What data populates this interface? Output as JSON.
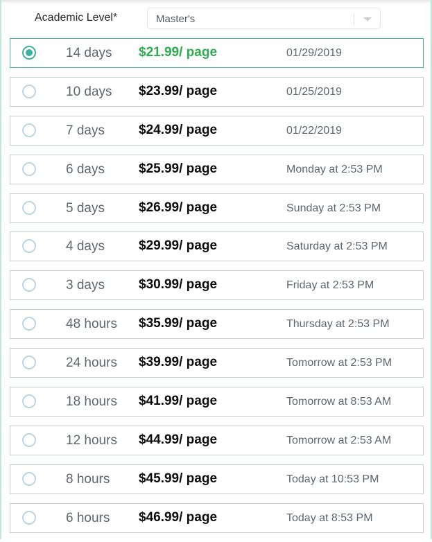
{
  "academic_level": {
    "label": "Academic Level*",
    "selected": "Master's"
  },
  "colors": {
    "accent": "#3fb1a3",
    "selected_price": "#2eaa4f",
    "radio_unselected": "#b9d6e6",
    "panel_border": "#bfe9d8"
  },
  "options": [
    {
      "duration": "14 days",
      "price": "$21.99/ page",
      "deadline": "01/29/2019",
      "selected": true
    },
    {
      "duration": "10 days",
      "price": "$23.99/ page",
      "deadline": "01/25/2019",
      "selected": false
    },
    {
      "duration": "7 days",
      "price": "$24.99/ page",
      "deadline": "01/22/2019",
      "selected": false
    },
    {
      "duration": "6 days",
      "price": "$25.99/ page",
      "deadline": "Monday at 2:53 PM",
      "selected": false
    },
    {
      "duration": "5 days",
      "price": "$26.99/ page",
      "deadline": "Sunday at 2:53 PM",
      "selected": false
    },
    {
      "duration": "4 days",
      "price": "$29.99/ page",
      "deadline": "Saturday at 2:53 PM",
      "selected": false
    },
    {
      "duration": "3 days",
      "price": "$30.99/ page",
      "deadline": "Friday at 2:53 PM",
      "selected": false
    },
    {
      "duration": "48 hours",
      "price": "$35.99/ page",
      "deadline": "Thursday at 2:53 PM",
      "selected": false
    },
    {
      "duration": "24 hours",
      "price": "$39.99/ page",
      "deadline": "Tomorrow at 2:53 PM",
      "selected": false
    },
    {
      "duration": "18 hours",
      "price": "$41.99/ page",
      "deadline": "Tomorrow at 8:53 AM",
      "selected": false
    },
    {
      "duration": "12 hours",
      "price": "$44.99/ page",
      "deadline": "Tomorrow at 2:53 AM",
      "selected": false
    },
    {
      "duration": "8 hours",
      "price": "$45.99/ page",
      "deadline": "Today at 10:53 PM",
      "selected": false
    },
    {
      "duration": "6 hours",
      "price": "$46.99/ page",
      "deadline": "Today at 8:53 PM",
      "selected": false
    }
  ]
}
